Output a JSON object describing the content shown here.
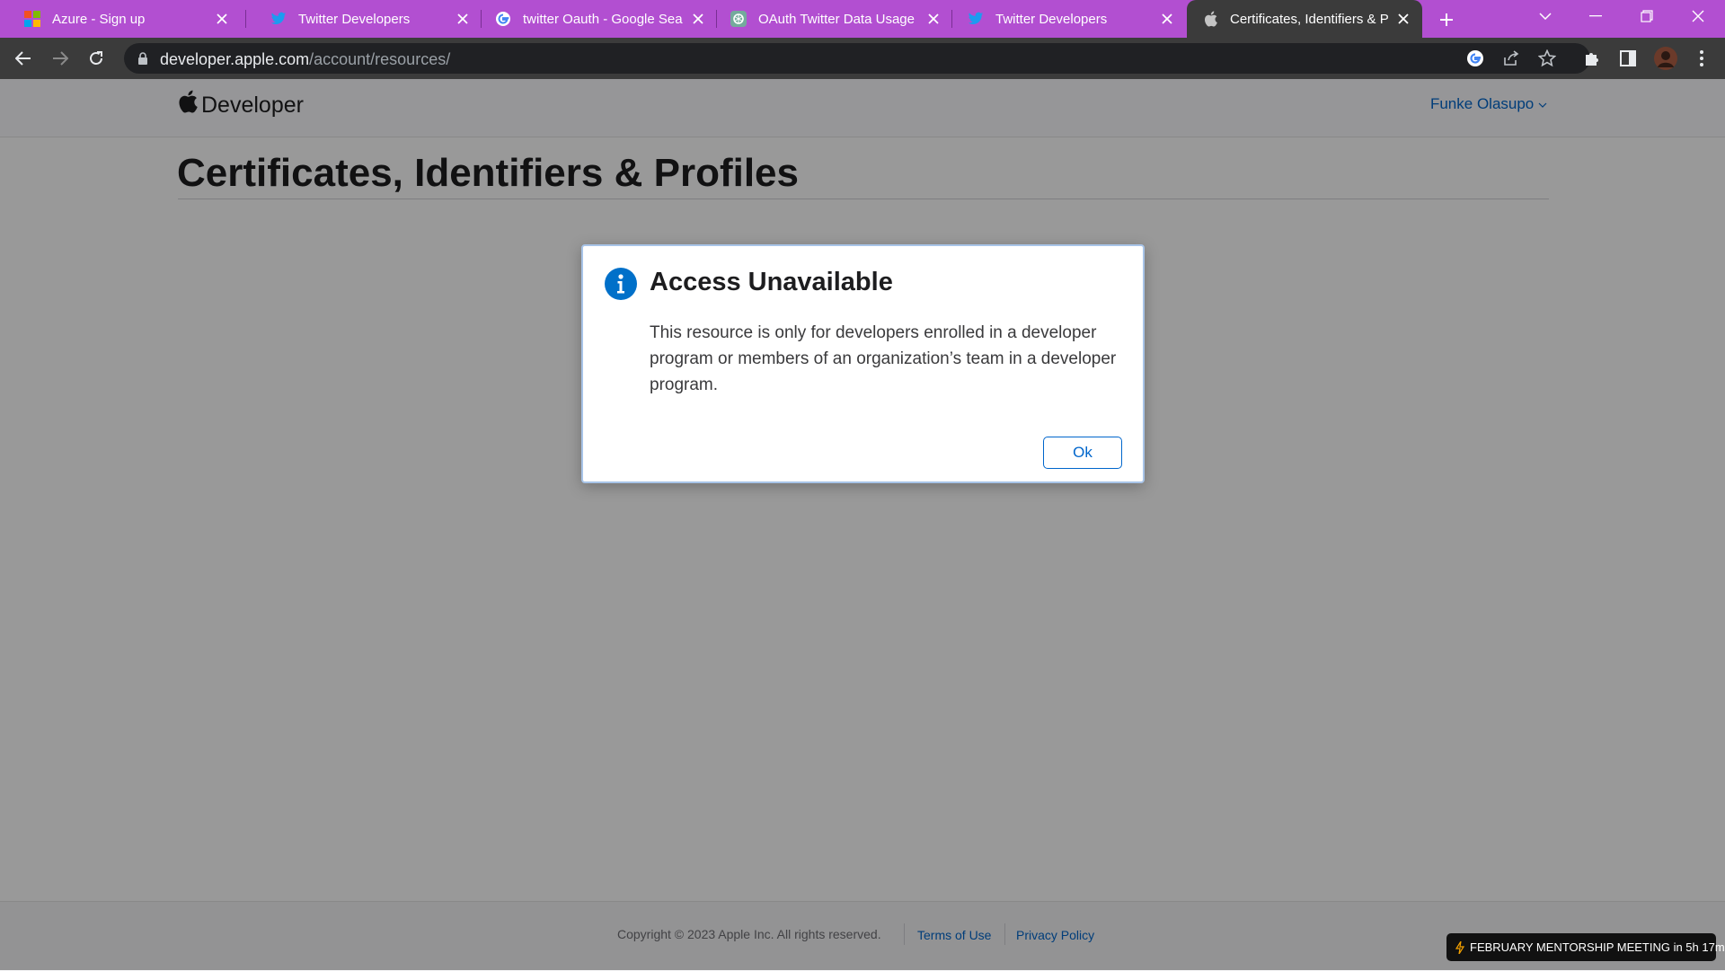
{
  "browser": {
    "tabs": [
      {
        "title": "Azure - Sign up",
        "icon": "microsoft-logo-icon",
        "active": false
      },
      {
        "title": "Twitter Developers",
        "icon": "twitter-bird-icon",
        "active": false
      },
      {
        "title": "twitter Oauth - Google Search",
        "icon": "google-g-icon",
        "active": false
      },
      {
        "title": "OAuth Twitter Data Usage",
        "icon": "chatgpt-icon",
        "active": false
      },
      {
        "title": "Twitter Developers",
        "icon": "twitter-bird-icon",
        "active": false
      },
      {
        "title": "Certificates, Identifiers & Profiles",
        "icon": "apple-logo-icon",
        "active": true
      }
    ],
    "url_host": "developer.apple.com",
    "url_path": "/account/resources/",
    "colors": {
      "tab_strip": "#b24fd1",
      "toolbar": "#3b3b3b",
      "omnibox": "#202124"
    }
  },
  "header": {
    "brand": "Developer",
    "account_name": "Funke Olasupo"
  },
  "page": {
    "heading": "Certificates, Identifiers & Profiles"
  },
  "dialog": {
    "title": "Access Unavailable",
    "message": "This resource is only for developers enrolled in a developer program or members of an organization’s team in a developer program.",
    "ok_label": "Ok"
  },
  "footer": {
    "copyright": "Copyright © 2023 Apple Inc. All rights reserved.",
    "terms_label": "Terms of Use",
    "privacy_label": "Privacy Policy"
  },
  "notification": {
    "text": "FEBRUARY MENTORSHIP MEETING in 5h 17m"
  },
  "colors": {
    "link": "#0066cc",
    "accent_blue": "#0070c9"
  }
}
